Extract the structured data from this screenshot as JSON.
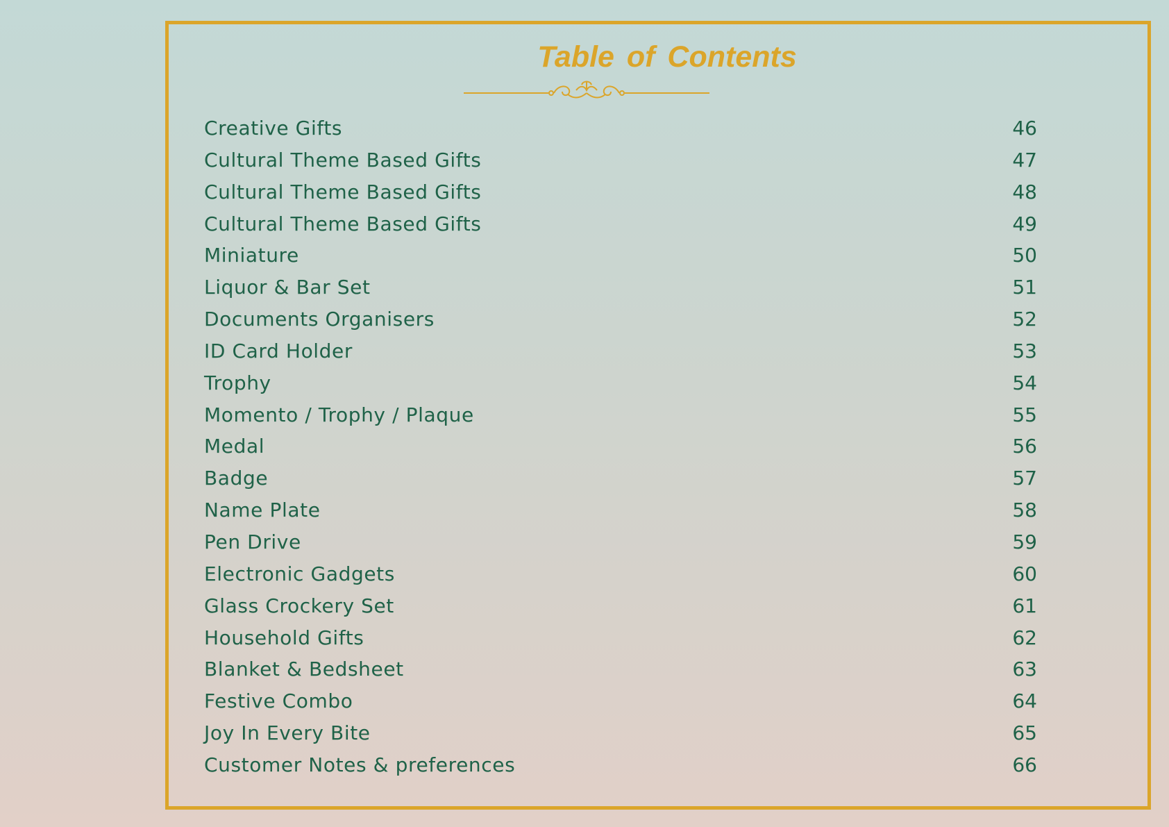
{
  "title": "Table of Contents",
  "colors": {
    "accent": "#dba52a",
    "text": "#1f6248"
  },
  "ornament_icon": "flourish-divider-icon",
  "entries": [
    {
      "label": "Creative Gifts",
      "page": "46"
    },
    {
      "label": "Cultural Theme Based Gifts",
      "page": "47"
    },
    {
      "label": "Cultural Theme Based Gifts",
      "page": "48"
    },
    {
      "label": "Cultural Theme Based Gifts",
      "page": "49"
    },
    {
      "label": "Miniature",
      "page": "50"
    },
    {
      "label": "Liquor & Bar Set",
      "page": "51"
    },
    {
      "label": "Documents Organisers",
      "page": "52"
    },
    {
      "label": "ID Card Holder",
      "page": "53"
    },
    {
      "label": "Trophy",
      "page": "54"
    },
    {
      "label": "Momento / Trophy / Plaque",
      "page": "55"
    },
    {
      "label": "Medal",
      "page": "56"
    },
    {
      "label": "Badge",
      "page": "57"
    },
    {
      "label": "Name Plate",
      "page": "58"
    },
    {
      "label": "Pen Drive",
      "page": "59"
    },
    {
      "label": "Electronic Gadgets",
      "page": "60"
    },
    {
      "label": "Glass Crockery Set",
      "page": "61"
    },
    {
      "label": "Household Gifts",
      "page": "62"
    },
    {
      "label": "Blanket & Bedsheet",
      "page": "63"
    },
    {
      "label": "Festive Combo",
      "page": "64"
    },
    {
      "label": "Joy In Every Bite",
      "page": "65"
    },
    {
      "label": "Customer Notes & preferences",
      "page": "66"
    }
  ]
}
